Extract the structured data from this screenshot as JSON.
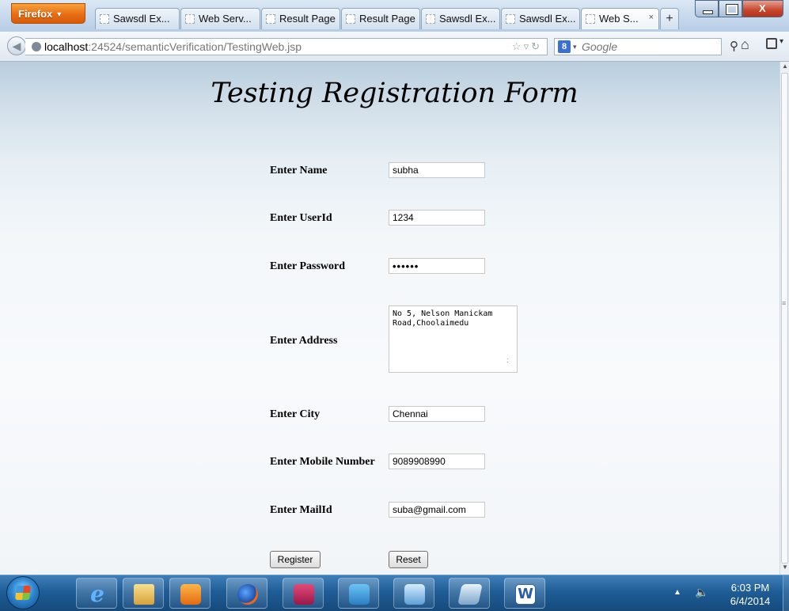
{
  "browser": {
    "menu_button_label": "Firefox",
    "tabs": [
      {
        "label": "Sawsdl Ex..."
      },
      {
        "label": "Web Serv..."
      },
      {
        "label": "Result Page"
      },
      {
        "label": "Result Page"
      },
      {
        "label": "Sawsdl Ex..."
      },
      {
        "label": "Sawsdl Ex..."
      },
      {
        "label": "Web S...",
        "active": true
      }
    ],
    "new_tab_label": "+",
    "url_host": "localhost",
    "url_rest": ":24524/semanticVerification/TestingWeb.jsp",
    "search_engine_icon": "google-g-icon",
    "search_engine_letter": "8",
    "search_placeholder": "Google"
  },
  "form": {
    "title": "Testing Registration Form",
    "fields": [
      {
        "label": "Enter Name",
        "value": "subha"
      },
      {
        "label": "Enter UserId",
        "value": "1234"
      },
      {
        "label": "Enter Password",
        "value": "••••••"
      },
      {
        "label": "Enter Address",
        "value": "No 5, Nelson Manickam\nRoad,Choolaimedu"
      },
      {
        "label": "Enter City",
        "value": "Chennai"
      },
      {
        "label": "Enter Mobile Number",
        "value": "9089908990"
      },
      {
        "label": "Enter MailId",
        "value": "suba@gmail.com"
      }
    ],
    "register_label": "Register",
    "reset_label": "Reset"
  },
  "taskbar": {
    "apps": [
      "internet-explorer-icon",
      "windows-explorer-icon",
      "media-player-icon",
      "firefox-icon",
      "access-icon",
      "config-icon",
      "virtualbox-icon",
      "notepad-icon",
      "word-icon"
    ],
    "ie_glyph": "e",
    "word_glyph": "W",
    "time": "6:03 PM",
    "date": "6/4/2014"
  },
  "colors": {
    "firefox_orange": "#e86d13",
    "taskbar_blue": "#1f5d97"
  }
}
